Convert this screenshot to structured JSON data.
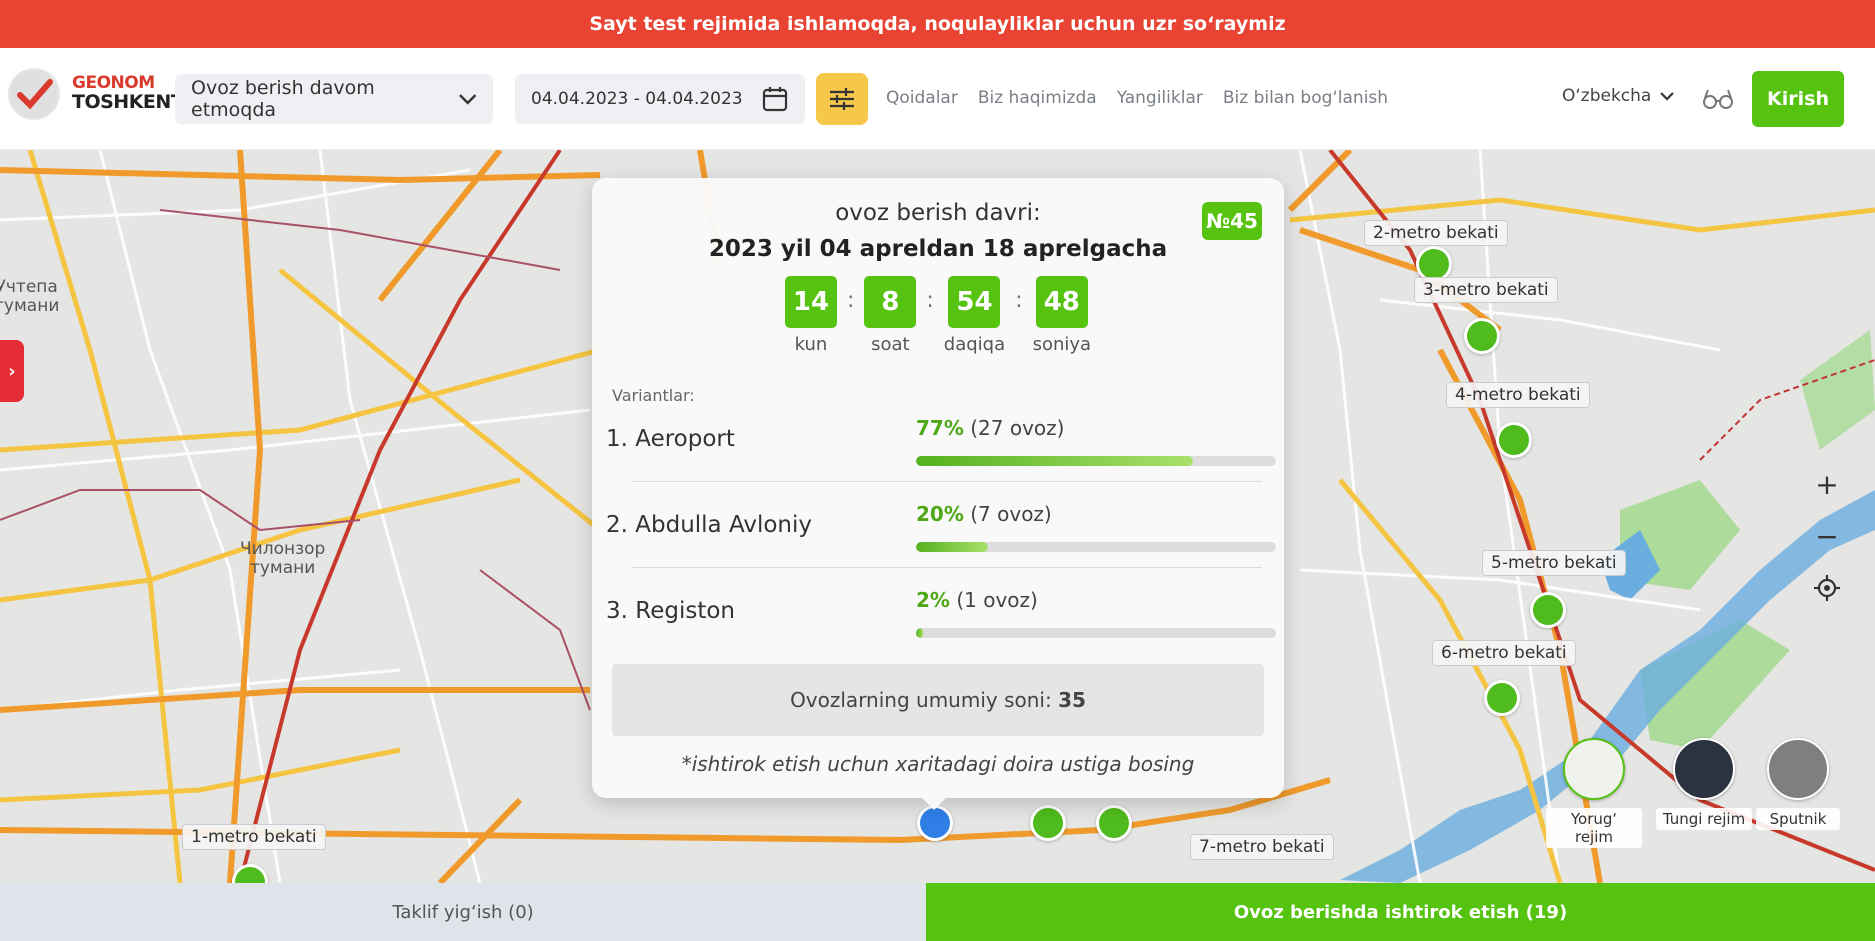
{
  "banner": {
    "text": "Sayt test rejimida ishlamoqda, noqulayliklar uchun uzr so‘raymiz"
  },
  "header": {
    "logo_top": "GEONOM",
    "logo_bottom": "TOSHKENT",
    "status_select": "Ovoz berish davom etmoqda",
    "date_range": "04.04.2023 - 04.04.2023",
    "nav": [
      "Qoidalar",
      "Biz haqimizda",
      "Yangiliklar",
      "Biz bilan bog‘lanish"
    ],
    "language": "O‘zbekcha",
    "login": "Kirish"
  },
  "map": {
    "districts": [
      {
        "text": "Учтепа\nтумани"
      },
      {
        "text": "Чилонзор\nтумани"
      }
    ],
    "stations": [
      {
        "label": "2-metro bekati"
      },
      {
        "label": "3-metro bekati"
      },
      {
        "label": "4-metro bekati"
      },
      {
        "label": "5-metro bekati"
      },
      {
        "label": "6-metro bekati"
      },
      {
        "label": "1-metro bekati"
      },
      {
        "label": "7-metro bekati"
      }
    ],
    "layers": [
      "Yorug‘ rejim",
      "Tungi rejim",
      "Sputnik"
    ]
  },
  "card": {
    "number": "№45",
    "period_label": "ovoz berish davri:",
    "period_dates": "2023 yil 04 apreldan 18 aprelgacha",
    "countdown": [
      {
        "value": "14",
        "label": "kun"
      },
      {
        "value": "8",
        "label": "soat"
      },
      {
        "value": "54",
        "label": "daqiqa"
      },
      {
        "value": "48",
        "label": "soniya"
      }
    ],
    "variants_label": "Variantlar:",
    "options": [
      {
        "name": "1. Aeroport",
        "percent": "77%",
        "votes": "(27 ovoz)",
        "share": 0.77
      },
      {
        "name": "2. Abdulla Avloniy",
        "percent": "20%",
        "votes": "(7 ovoz)",
        "share": 0.2
      },
      {
        "name": "3. Registon",
        "percent": "2%",
        "votes": "(1 ovoz)",
        "share": 0.02
      }
    ],
    "total_label": "Ovozlarning umumiy soni:",
    "total_value": "35",
    "note": "*ishtirok etish uchun xaritadagi doira ustiga bosing"
  },
  "bottom": {
    "left": "Taklif yig‘ish (0)",
    "right": "Ovoz berishda ishtirok etish (19)"
  }
}
